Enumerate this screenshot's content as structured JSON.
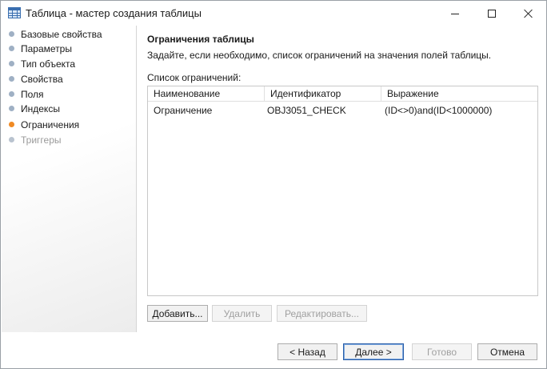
{
  "window": {
    "title": "Таблица - мастер создания таблицы"
  },
  "sidebar": {
    "items": [
      {
        "label": "Базовые свойства",
        "state": "done"
      },
      {
        "label": "Параметры",
        "state": "done"
      },
      {
        "label": "Тип объекта",
        "state": "done"
      },
      {
        "label": "Свойства",
        "state": "done"
      },
      {
        "label": "Поля",
        "state": "done"
      },
      {
        "label": "Индексы",
        "state": "done"
      },
      {
        "label": "Ограничения",
        "state": "active"
      },
      {
        "label": "Триггеры",
        "state": "disabled"
      }
    ]
  },
  "main": {
    "title": "Ограничения таблицы",
    "description": "Задайте, если необходимо, список ограничений на значения полей таблицы.",
    "list_label": "Список ограничений:",
    "columns": [
      "Наименование",
      "Идентификатор",
      "Выражение"
    ],
    "rows": [
      [
        "Ограничение",
        "OBJ3051_CHECK",
        "(ID<>0)and(ID<1000000)"
      ]
    ],
    "buttons": {
      "add": "Добавить...",
      "delete": "Удалить",
      "edit": "Редактировать..."
    }
  },
  "footer": {
    "back": "< Назад",
    "next": "Далее >",
    "finish": "Готово",
    "cancel": "Отмена"
  },
  "colors": {
    "active_step": "#f08a24",
    "done_step": "#9fb0c4",
    "default_button_border": "#2b5fa8"
  },
  "icons": {
    "app": "table-icon",
    "minimize": "minimize-icon",
    "maximize": "maximize-icon",
    "close": "close-icon"
  }
}
